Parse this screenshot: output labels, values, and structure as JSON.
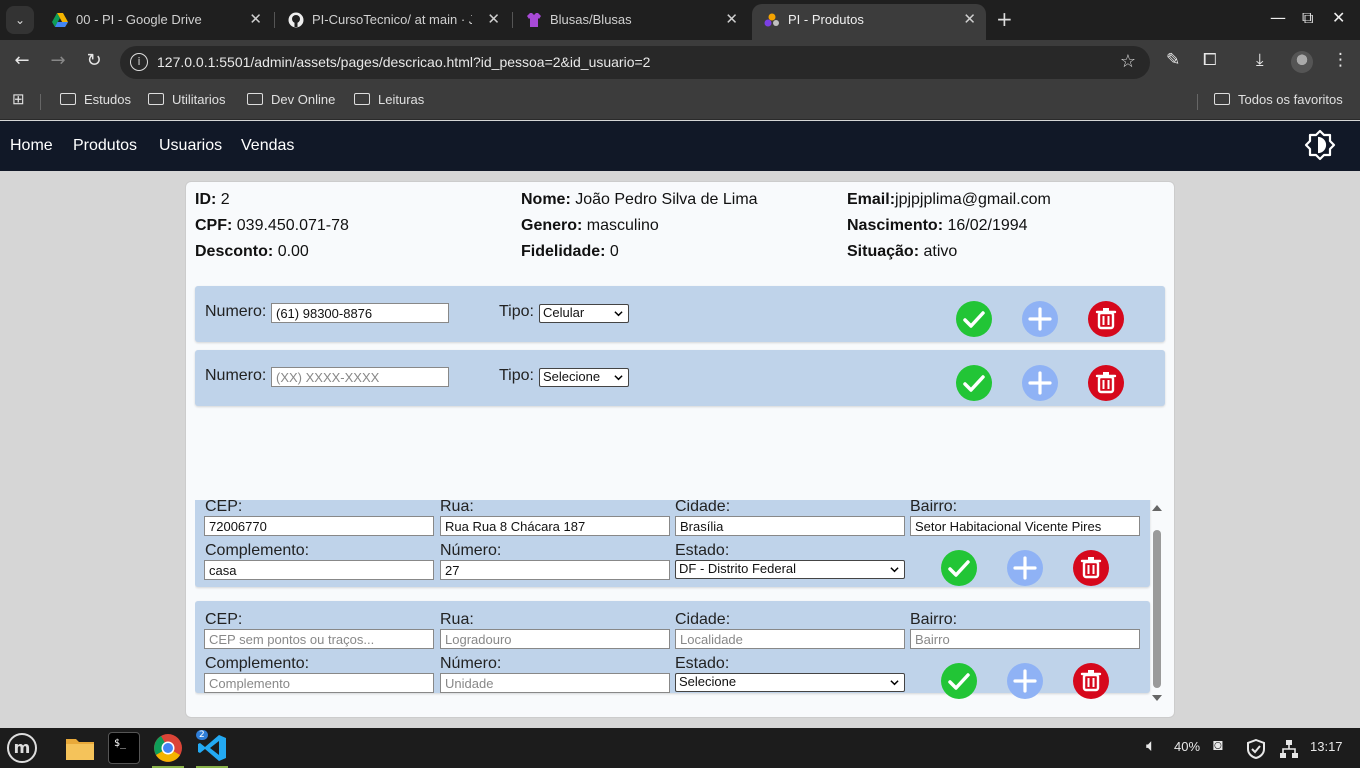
{
  "browser": {
    "tabs": [
      {
        "title": "00 - PI - Google Drive",
        "active": false
      },
      {
        "title": "PI-CursoTecnico/ at main · Jo",
        "active": false
      },
      {
        "title": "Blusas/Blusas",
        "active": false
      },
      {
        "title": "PI - Produtos",
        "active": true
      }
    ],
    "url": "127.0.0.1:5501/admin/assets/pages/descricao.html?id_pessoa=2&id_usuario=2",
    "bookmarks": [
      "Estudos",
      "Utilitarios",
      "Dev Online",
      "Leituras"
    ],
    "all_bookmarks": "Todos os favoritos"
  },
  "nav": {
    "items": [
      "Home",
      "Produtos",
      "Usuarios",
      "Vendas"
    ]
  },
  "person": {
    "id_label": "ID:",
    "id": "2",
    "cpf_label": "CPF:",
    "cpf": "039.450.071-78",
    "desconto_label": "Desconto:",
    "desconto": "0.00",
    "nome_label": "Nome:",
    "nome": "João Pedro Silva de Lima",
    "genero_label": "Genero:",
    "genero": "masculino",
    "fidelidade_label": "Fidelidade:",
    "fidelidade": "0",
    "email_label": "Email:",
    "email": "jpjpjplima@gmail.com",
    "nascimento_label": "Nascimento:",
    "nascimento": "16/02/1994",
    "situacao_label": "Situação:",
    "situacao": "ativo"
  },
  "phones": {
    "numero_label": "Numero:",
    "tipo_label": "Tipo:",
    "rows": [
      {
        "numero": "(61) 98300-8876",
        "placeholder": "(XX) XXXX-XXXX",
        "tipo": "Celular"
      },
      {
        "numero": "",
        "placeholder": "(XX) XXXX-XXXX",
        "tipo": "Selecione"
      }
    ]
  },
  "addresses": {
    "labels": {
      "cep": "CEP:",
      "rua": "Rua:",
      "cidade": "Cidade:",
      "bairro": "Bairro:",
      "complemento": "Complemento:",
      "numero": "Número:",
      "estado": "Estado:"
    },
    "placeholders": {
      "cep": "CEP sem pontos ou traços...",
      "rua": "Logradouro",
      "cidade": "Localidade",
      "bairro": "Bairro",
      "complemento": "Complemento",
      "numero": "Unidade"
    },
    "rows": [
      {
        "cep": "72006770",
        "rua": "Rua Rua 8 Chácara 187",
        "cidade": "Brasília",
        "bairro": "Setor Habitacional Vicente Pires",
        "complemento": "casa",
        "numero": "27",
        "estado": "DF - Distrito Federal"
      },
      {
        "cep": "",
        "rua": "",
        "cidade": "",
        "bairro": "",
        "complemento": "",
        "numero": "",
        "estado": "Selecione"
      }
    ]
  },
  "taskbar": {
    "volume": "40%",
    "clock": "13:17",
    "vscode_badge": "2"
  },
  "colors": {
    "nav_bg": "#111827",
    "row_bg": "#bfd3ea",
    "ok": "#22c536",
    "add": "#8fb2f5",
    "delete": "#d6081c"
  }
}
